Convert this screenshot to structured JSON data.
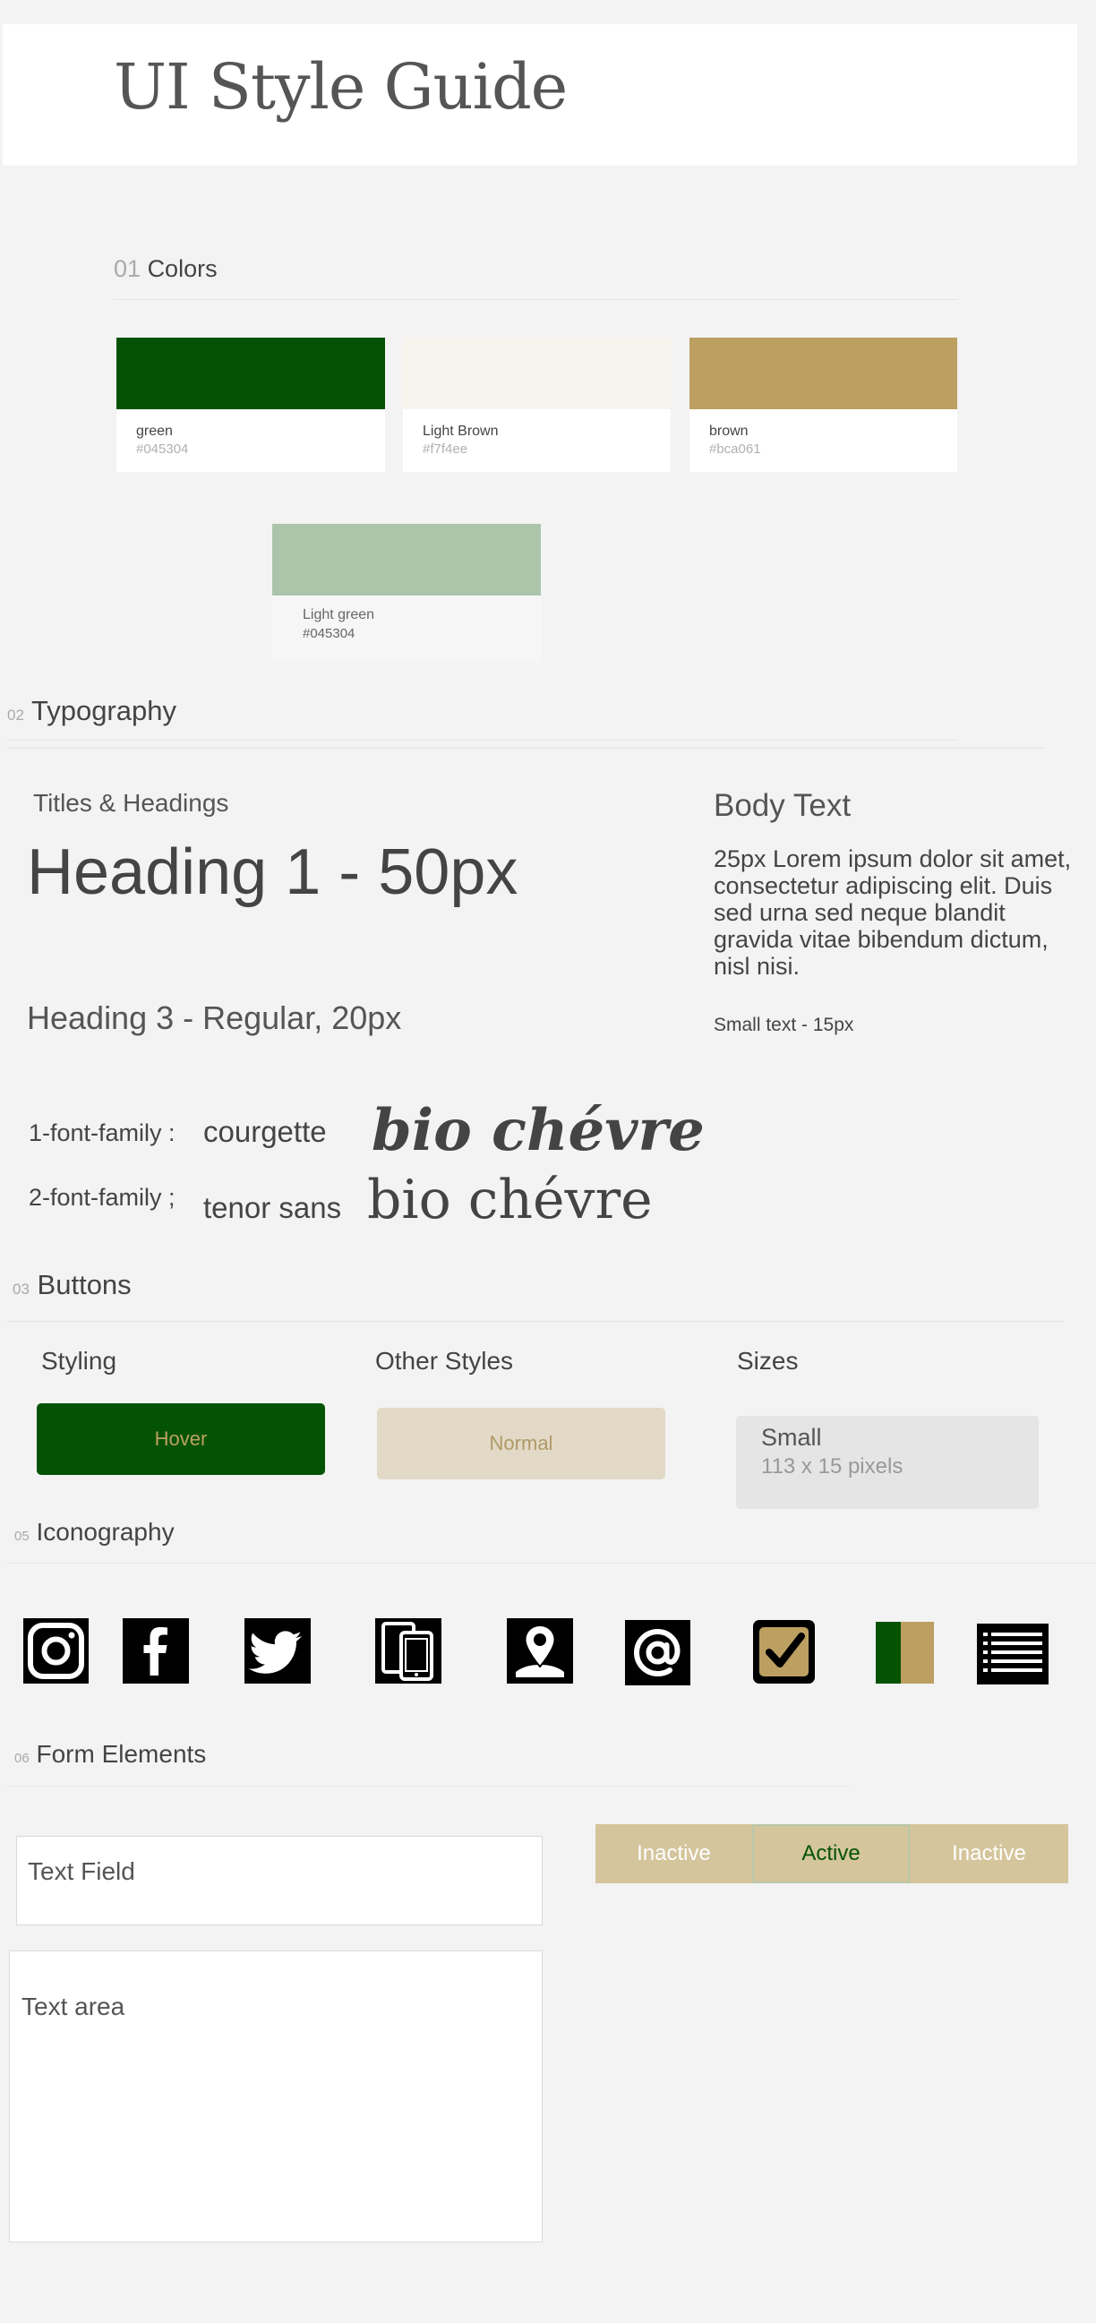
{
  "page": {
    "title": "UI Style Guide"
  },
  "colors": {
    "number": "01",
    "title": "Colors",
    "swatches": [
      {
        "name": "green",
        "hex": "#045304",
        "fill": "#045304"
      },
      {
        "name": "Light Brown",
        "hex": "#f7f4ee",
        "fill": "#f7f4ee"
      },
      {
        "name": "brown",
        "hex": "#bca061",
        "fill": "#bca061"
      },
      {
        "name": "Light green",
        "hex": "#045304",
        "fill": "#abc4aa"
      }
    ]
  },
  "typography": {
    "number": "02",
    "title": "Typography",
    "titles_heading": "Titles & Headings",
    "heading1": "Heading 1 - 50px",
    "heading3": "Heading 3 - Regular, 20px",
    "body_heading": "Body Text",
    "body_text": "25px Lorem ipsum dolor sit amet, consectetur adipiscing elit. Duis sed urna sed neque blandit gravida vitae bibendum dictum, nisl nisi.",
    "small_text": "Small text - 15px",
    "font_families": [
      {
        "label": "1-font-family :",
        "name": "courgette",
        "sample": "bio chévre"
      },
      {
        "label": "2-font-family ;",
        "name": "tenor sans",
        "sample": "bio chévre"
      }
    ]
  },
  "buttons": {
    "number": "03",
    "title": "Buttons",
    "styling_label": "Styling",
    "hover_label": "Hover",
    "other_label": "Other Styles",
    "normal_label": "Normal",
    "sizes_label": "Sizes",
    "small_title": "Small",
    "small_dims": "113 x 15 pixels"
  },
  "iconography": {
    "number": "05",
    "title": "Iconography",
    "icons": [
      "instagram-icon",
      "facebook-icon",
      "twitter-icon",
      "devices-icon",
      "location-pin-icon",
      "at-sign-icon",
      "checkbox-icon",
      "color-split-icon",
      "list-icon"
    ]
  },
  "forms": {
    "number": "06",
    "title": "Form Elements",
    "text_field_placeholder": "Text Field",
    "text_area_placeholder": "Text area",
    "segments": [
      {
        "label": "Inactive",
        "state": "inactive"
      },
      {
        "label": "Active",
        "state": "active"
      },
      {
        "label": "Inactive",
        "state": "inactive"
      }
    ]
  }
}
